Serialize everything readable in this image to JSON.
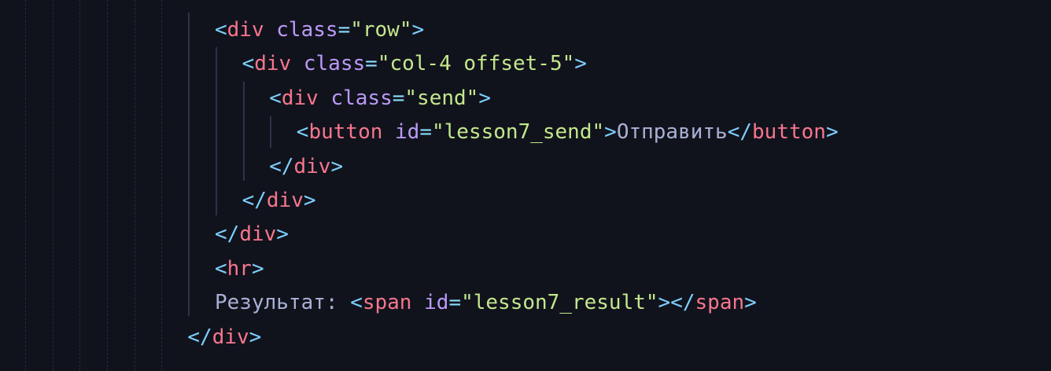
{
  "lines": [
    {
      "indent": 0,
      "t": [
        "<",
        "div",
        " ",
        "class",
        "=",
        "\"row\"",
        ">"
      ]
    },
    {
      "indent": 1,
      "t": [
        "<",
        "div",
        " ",
        "class",
        "=",
        "\"col-4 offset-5\"",
        ">"
      ]
    },
    {
      "indent": 2,
      "t": [
        "<",
        "div",
        " ",
        "class",
        "=",
        "\"send\"",
        ">"
      ]
    },
    {
      "indent": 3,
      "t": [
        "<",
        "button",
        " ",
        "id",
        "=",
        "\"lesson7_send\"",
        ">",
        "Отправить",
        "</",
        "button",
        ">"
      ]
    },
    {
      "indent": 2,
      "t": [
        "</",
        "div",
        ">"
      ]
    },
    {
      "indent": 1,
      "t": [
        "</",
        "div",
        ">"
      ]
    },
    {
      "indent": 0,
      "t": [
        "</",
        "div",
        ">"
      ]
    },
    {
      "indent": 0,
      "t": [
        "<",
        "hr",
        ">"
      ]
    },
    {
      "indent": 0,
      "t": [
        "Результат: ",
        "<",
        "span",
        " ",
        "id",
        "=",
        "\"lesson7_result\"",
        ">",
        "</",
        "span",
        ">"
      ]
    },
    {
      "indent": -1,
      "t": [
        "</",
        "div",
        ">"
      ]
    }
  ],
  "theme": {
    "background": "#11131c",
    "bracket": "#7dcfff",
    "tag": "#f7768e",
    "attribute": "#bb9af7",
    "equals": "#89ddff",
    "string": "#c3e88d",
    "text": "#a9b1d6"
  }
}
